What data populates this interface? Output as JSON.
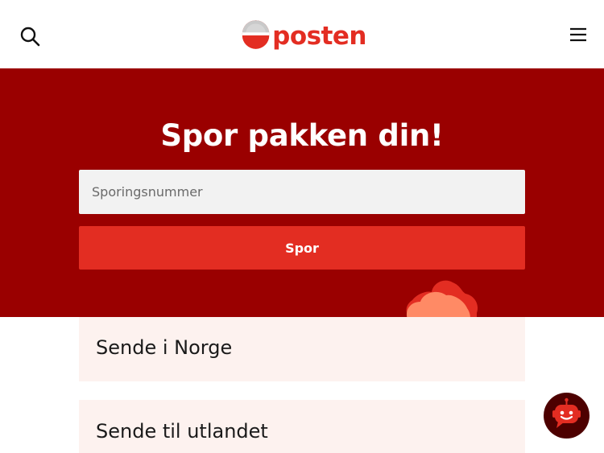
{
  "header": {
    "logo_text": "posten",
    "search_icon": "search-icon",
    "menu_icon": "hamburger-menu-icon"
  },
  "hero": {
    "title": "Spor pakken din!",
    "tracking_placeholder": "Sporingsnummer",
    "tracking_value": "",
    "track_button_label": "Spor"
  },
  "services": [
    {
      "label": "Sende i Norge"
    },
    {
      "label": "Sende til utlandet"
    }
  ],
  "chat": {
    "icon": "chatbot-icon"
  },
  "colors": {
    "brand_red": "#e32d22",
    "hero_background": "#9a0000",
    "card_background": "#fdf2ef",
    "chat_background": "#4d0000"
  }
}
